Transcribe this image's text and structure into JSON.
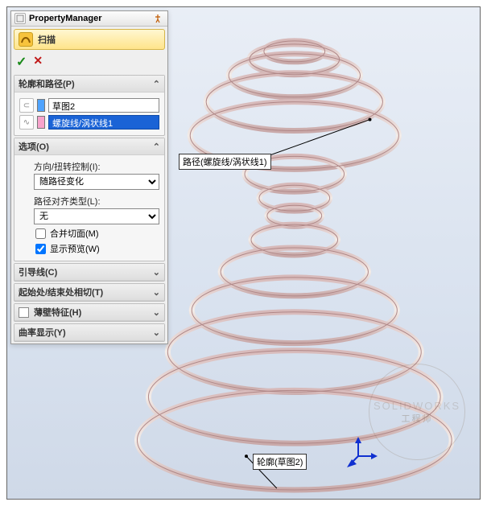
{
  "pm": {
    "title": "PropertyManager",
    "feature_name": "扫描",
    "sections": {
      "profile_path": {
        "header": "轮廓和路径(P)",
        "profile_value": "草图2",
        "path_value": "螺旋线/涡状线1"
      },
      "options": {
        "header": "选项(O)",
        "twist_label": "方向/扭转控制(I):",
        "twist_value": "随路径变化",
        "align_label": "路径对齐类型(L):",
        "align_value": "无",
        "merge_label": "合并切面(M)",
        "merge_checked": false,
        "preview_label": "显示预览(W)",
        "preview_checked": true
      },
      "guide": {
        "header": "引导线(C)"
      },
      "startend": {
        "header": "起始处/结束处相切(T)"
      },
      "thin": {
        "header": "薄壁特征(H)",
        "checked": false
      },
      "curvature": {
        "header": "曲率显示(Y)"
      }
    }
  },
  "viewport": {
    "callout_path": "路径(螺旋线/涡状线1)",
    "callout_profile": "轮廓(草图2)"
  },
  "icons": {
    "pm": "pm-icon",
    "pin": "pin-icon",
    "sweep": "sweep-icon",
    "ok": "✓",
    "cancel": "✕",
    "chev": "⌄",
    "chev2": "»"
  },
  "watermark": {
    "line1": "工程师"
  }
}
